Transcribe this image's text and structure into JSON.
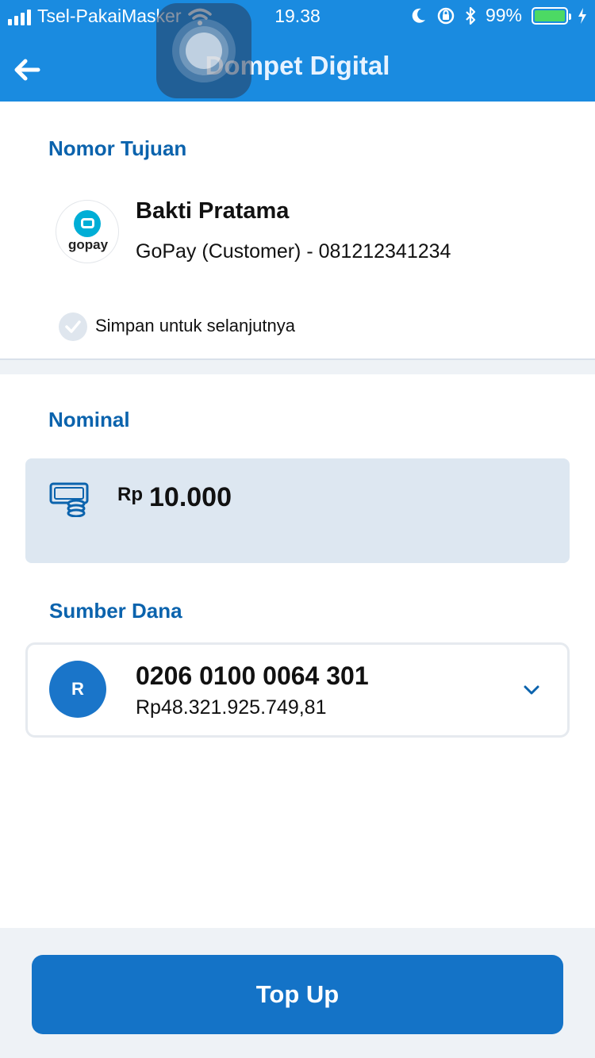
{
  "status_bar": {
    "carrier": "Tsel-PakaiMasker",
    "time": "19.38",
    "battery": "99%"
  },
  "header": {
    "title": "Dompet Digital"
  },
  "destination": {
    "section_title": "Nomor Tujuan",
    "logo_text": "gopay",
    "name": "Bakti Pratama",
    "detail": "GoPay (Customer) - 081212341234",
    "save_label": "Simpan untuk selanjutnya"
  },
  "nominal": {
    "section_title": "Nominal",
    "currency": "Rp",
    "amount": "10.000"
  },
  "source": {
    "section_title": "Sumber Dana",
    "avatar_letter": "R",
    "account_number": "0206 0100 0064 301",
    "balance": "Rp48.321.925.749,81"
  },
  "footer": {
    "topup_label": "Top Up"
  },
  "colors": {
    "header": "#1a8be0",
    "accent": "#0b63ad",
    "button": "#1473c7"
  }
}
